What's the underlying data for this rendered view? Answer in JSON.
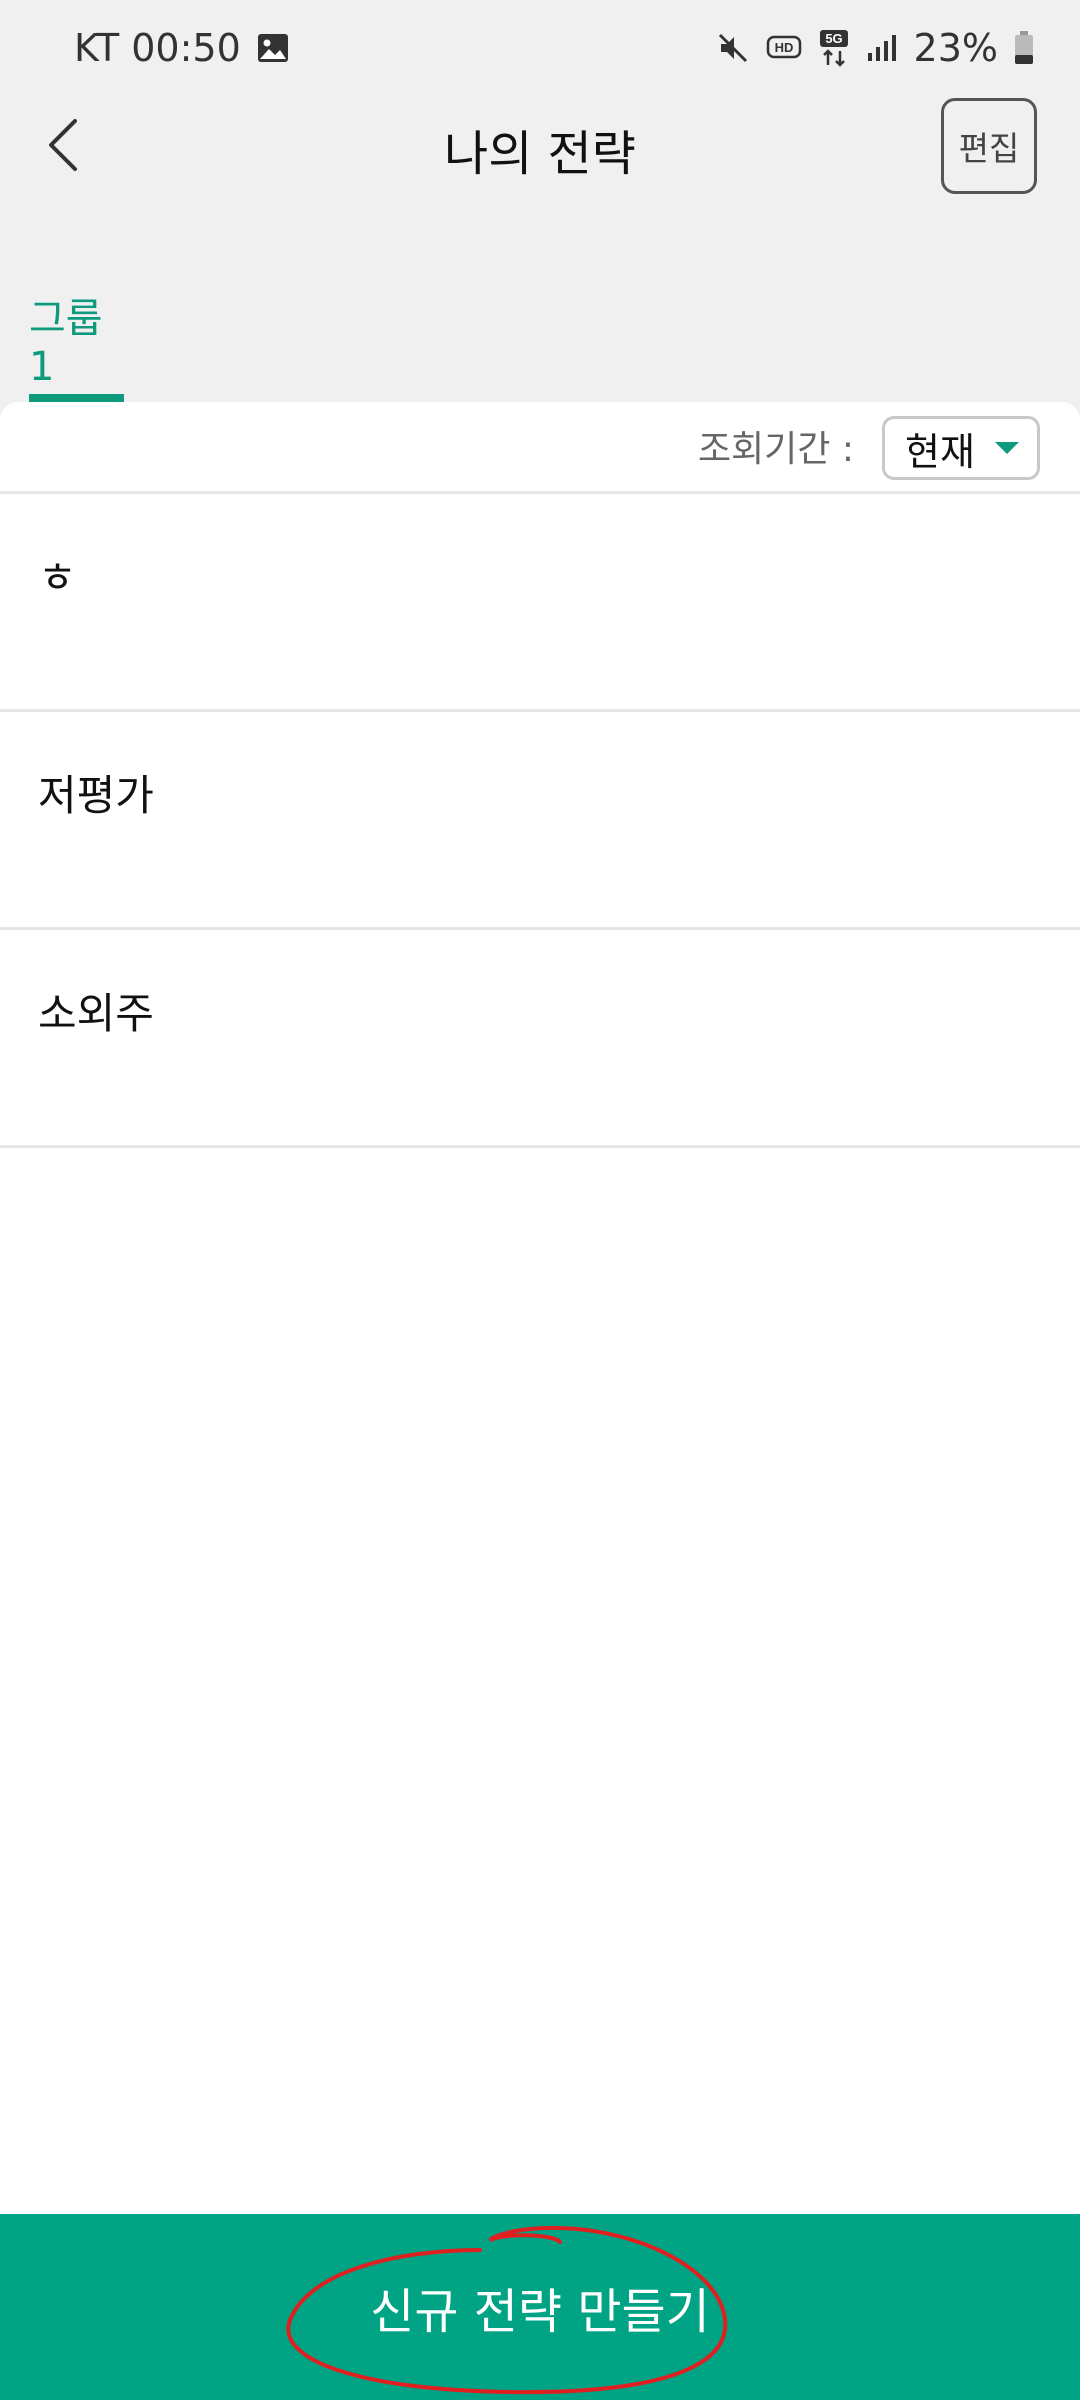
{
  "status_bar": {
    "carrier_time": "KT 00:50",
    "battery": "23%",
    "icons": [
      "gallery-icon",
      "mute-icon",
      "hd-icon",
      "5g-icon",
      "signal-icon",
      "battery-icon"
    ]
  },
  "header": {
    "title": "나의 전략",
    "edit_label": "편집",
    "back_icon": "back-chevron-icon"
  },
  "tabs": [
    {
      "label": "그룹1",
      "active": true
    }
  ],
  "filter": {
    "label": "조회기간 :",
    "value": "현재"
  },
  "strategies": [
    {
      "name": "ㅎ"
    },
    {
      "name": "저평가"
    },
    {
      "name": "소외주"
    }
  ],
  "cta": {
    "label": "신규 전략 만들기"
  },
  "colors": {
    "accent": "#00a383",
    "background": "#f0f0f0",
    "annotation": "#e02020"
  }
}
